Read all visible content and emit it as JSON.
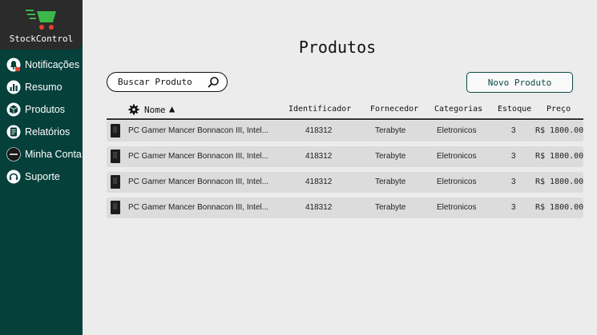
{
  "app": {
    "name": "StockControl"
  },
  "nav": [
    {
      "id": "notificacoes",
      "label": "Notificações"
    },
    {
      "id": "resumo",
      "label": "Resumo"
    },
    {
      "id": "produtos",
      "label": "Produtos"
    },
    {
      "id": "relatorios",
      "label": "Relatórios"
    },
    {
      "id": "minha-conta",
      "label": "Minha Conta"
    },
    {
      "id": "suporte",
      "label": "Suporte"
    }
  ],
  "page": {
    "title": "Produtos"
  },
  "search": {
    "label": "Buscar Produto"
  },
  "actions": {
    "new_product": "Novo Produto"
  },
  "table": {
    "columns": {
      "nome": "Nome",
      "identificador": "Identificador",
      "fornecedor": "Fornecedor",
      "categorias": "Categorias",
      "estoque": "Estoque",
      "preco": "Preço"
    },
    "sort_indicator": "▲",
    "rows": [
      {
        "nome": "PC Gamer Mancer Bonnacon III, Intel...",
        "identificador": "418312",
        "fornecedor": "Terabyte",
        "categorias": "Eletronicos",
        "estoque": "3",
        "preco": "R$ 1800.00"
      },
      {
        "nome": "PC Gamer Mancer Bonnacon III, Intel...",
        "identificador": "418312",
        "fornecedor": "Terabyte",
        "categorias": "Eletronicos",
        "estoque": "3",
        "preco": "R$ 1800.00"
      },
      {
        "nome": "PC Gamer Mancer Bonnacon III, Intel...",
        "identificador": "418312",
        "fornecedor": "Terabyte",
        "categorias": "Eletronicos",
        "estoque": "3",
        "preco": "R$ 1800.00"
      },
      {
        "nome": "PC Gamer Mancer Bonnacon III, Intel...",
        "identificador": "418312",
        "fornecedor": "Terabyte",
        "categorias": "Eletronicos",
        "estoque": "3",
        "preco": "R$ 1800.00"
      }
    ]
  },
  "colors": {
    "sidebar": "#05403b",
    "logo_bg": "#2b2b2b",
    "accent_green": "#3cb84a",
    "background": "#ececec",
    "row_bg": "#dcdcdc"
  },
  "icons": {
    "logo": "shopping-cart-icon",
    "notificacoes": "bell-icon",
    "resumo": "bar-chart-icon",
    "produtos": "box-icon",
    "relatorios": "document-icon",
    "minha_conta": "user-icon",
    "suporte": "headset-icon",
    "search": "magnifier-icon",
    "settings": "gear-icon"
  }
}
